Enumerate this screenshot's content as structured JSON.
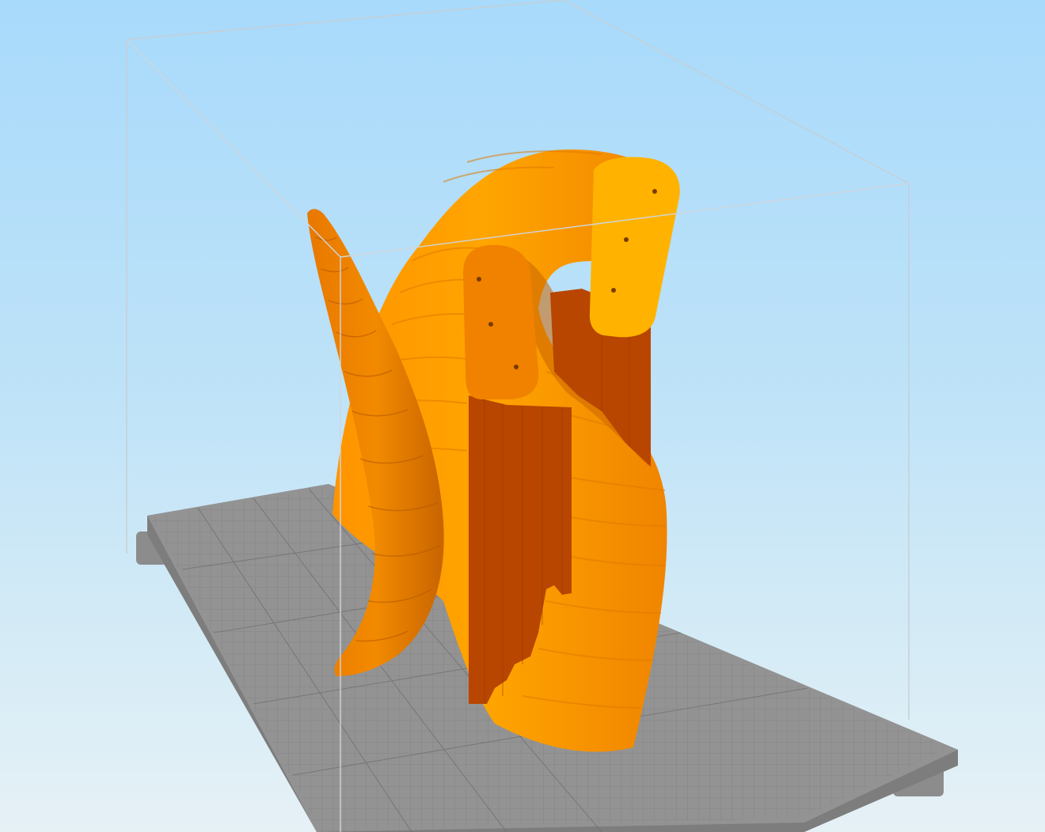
{
  "app": {
    "view": "3d-viewport"
  },
  "colors": {
    "background_top": "#a8dafb",
    "background_bottom": "#e6f1f6",
    "bed": "#8e8e8e",
    "bed_grid": "#7b7b7b",
    "build_volume": "#c8d0d6",
    "model_light": "#ffb400",
    "model_mid": "#ff9a00",
    "model_dark": "#e07000",
    "support": "#b84500"
  },
  "icons": {
    "plate": "print-bed-icon",
    "model": "horn-model-icon"
  }
}
